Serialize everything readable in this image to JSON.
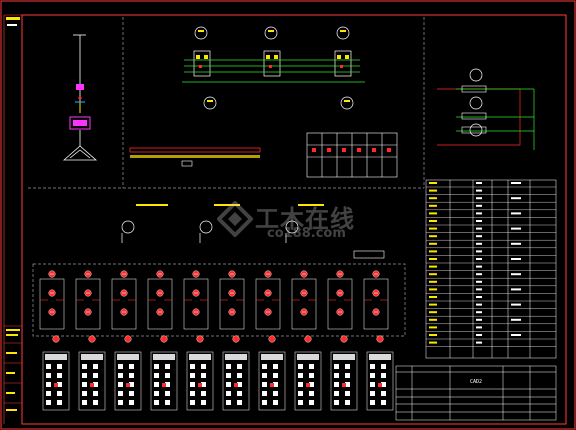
{
  "title_block": {
    "upper_label": "CAD2",
    "row_texts": [
      "",
      "",
      "",
      "",
      ""
    ]
  },
  "watermark": {
    "text": "工木在线",
    "sub": "co188.com"
  },
  "colors": {
    "border": "#ff3b3b",
    "line": "#ffffff",
    "dash": "#9a9a9a",
    "accent_green": "#2ee82e",
    "accent_yellow": "#ffe600",
    "accent_cyan": "#00c8ff",
    "accent_magenta": "#ff33ff",
    "accent_red": "#ff2a2a"
  },
  "icons": [
    "breaker-symbol",
    "transformer-delta",
    "meter-circle",
    "watermark-logo"
  ]
}
